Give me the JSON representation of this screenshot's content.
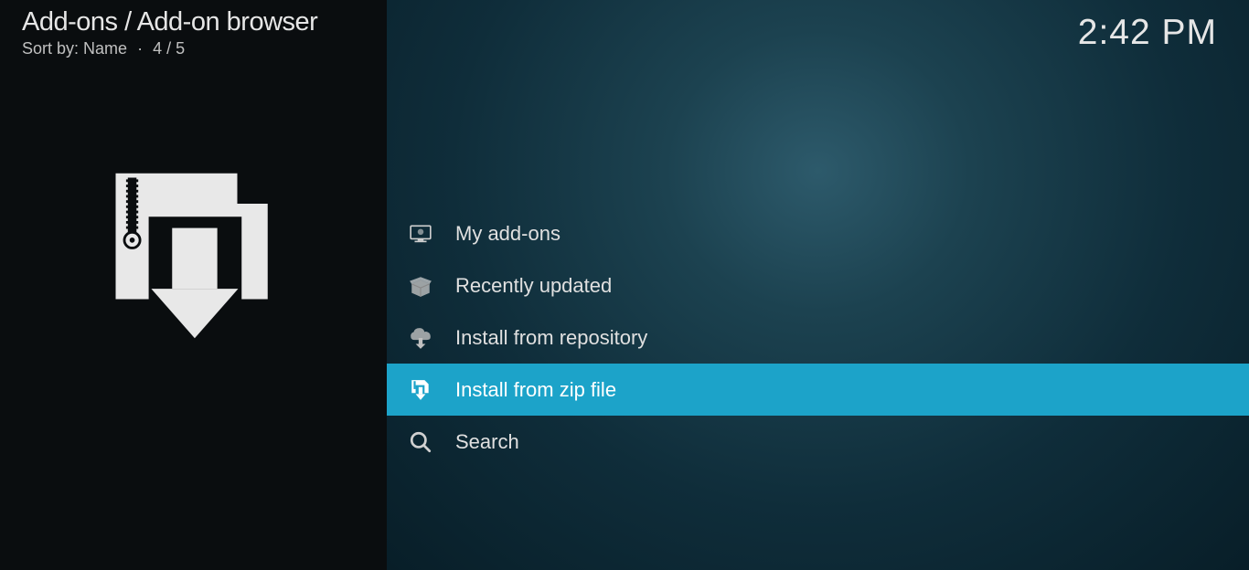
{
  "header": {
    "breadcrumb": "Add-ons / Add-on browser",
    "sort_label": "Sort by: Name",
    "position": "4 / 5"
  },
  "clock": "2:42 PM",
  "menu": {
    "items": [
      {
        "label": "My add-ons",
        "icon": "monitor-icon",
        "selected": false
      },
      {
        "label": "Recently updated",
        "icon": "box-open-icon",
        "selected": false
      },
      {
        "label": "Install from repository",
        "icon": "cloud-download-icon",
        "selected": false
      },
      {
        "label": "Install from zip file",
        "icon": "zip-download-icon",
        "selected": true
      },
      {
        "label": "Search",
        "icon": "search-icon",
        "selected": false
      }
    ]
  }
}
